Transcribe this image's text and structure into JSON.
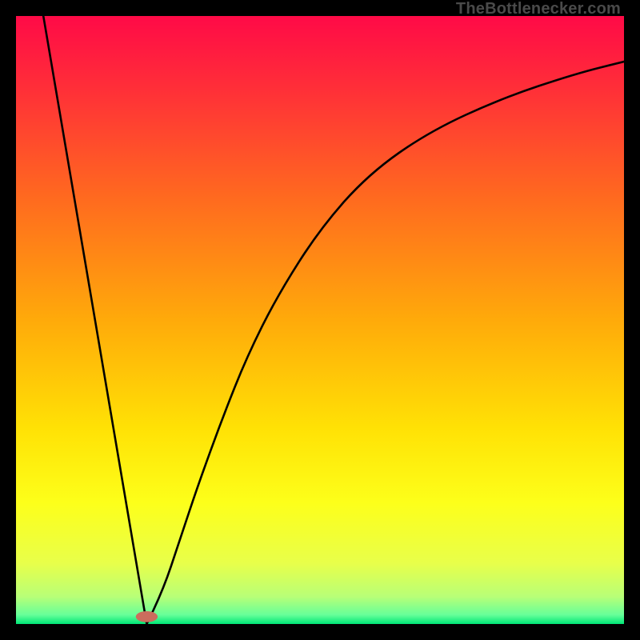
{
  "watermark": "TheBottlenecker.com",
  "chart_data": {
    "type": "line",
    "title": "",
    "xlabel": "",
    "ylabel": "",
    "xlim": [
      0,
      1
    ],
    "ylim": [
      0,
      1
    ],
    "gradient_stops": [
      {
        "offset": 0.0,
        "color": "#ff0a47"
      },
      {
        "offset": 0.12,
        "color": "#ff2f38"
      },
      {
        "offset": 0.3,
        "color": "#ff6a1f"
      },
      {
        "offset": 0.5,
        "color": "#ffaa0a"
      },
      {
        "offset": 0.68,
        "color": "#ffe205"
      },
      {
        "offset": 0.8,
        "color": "#fdff1a"
      },
      {
        "offset": 0.9,
        "color": "#e8ff4a"
      },
      {
        "offset": 0.955,
        "color": "#b8ff77"
      },
      {
        "offset": 0.985,
        "color": "#66ff99"
      },
      {
        "offset": 1.0,
        "color": "#00e676"
      }
    ],
    "vertex": {
      "x": 0.215,
      "y": 0.0
    },
    "left_line": {
      "x_start": 0.045,
      "y_start": 1.0
    },
    "right_curve": [
      {
        "x": 0.215,
        "y": 0.0
      },
      {
        "x": 0.24,
        "y": 0.05
      },
      {
        "x": 0.27,
        "y": 0.14
      },
      {
        "x": 0.3,
        "y": 0.23
      },
      {
        "x": 0.34,
        "y": 0.34
      },
      {
        "x": 0.38,
        "y": 0.44
      },
      {
        "x": 0.43,
        "y": 0.54
      },
      {
        "x": 0.5,
        "y": 0.65
      },
      {
        "x": 0.58,
        "y": 0.74
      },
      {
        "x": 0.68,
        "y": 0.81
      },
      {
        "x": 0.8,
        "y": 0.865
      },
      {
        "x": 0.92,
        "y": 0.905
      },
      {
        "x": 1.0,
        "y": 0.925
      }
    ],
    "marker": {
      "x": 0.215,
      "y": 0.012,
      "rx": 0.018,
      "ry": 0.009,
      "fill": "#cc6d5d"
    }
  }
}
